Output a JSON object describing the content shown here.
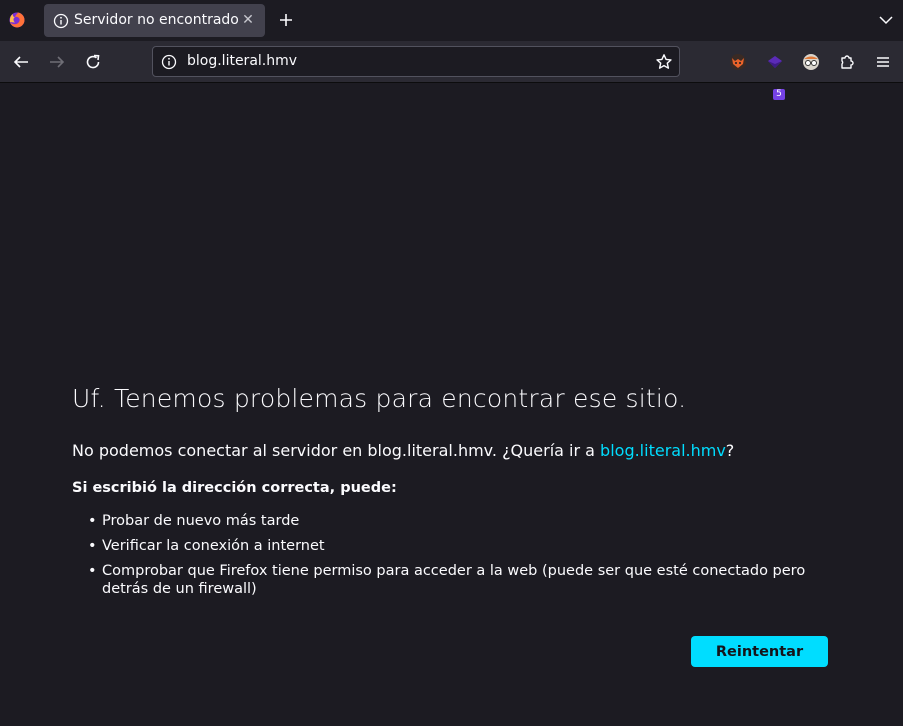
{
  "tab": {
    "title": "Servidor no encontrado",
    "close_glyph": "✕",
    "icon": "info-icon"
  },
  "browser": {
    "logo": "firefox-logo",
    "url": "blog.literal.hmv",
    "extensions": [
      "extension-fox-icon",
      "extension-purple-icon",
      "extension-glasses-icon",
      "extensions-puzzle-icon"
    ],
    "extension_badge": "5"
  },
  "error": {
    "title": "Uf. Tenemos problemas para encontrar ese sitio.",
    "desc_prefix": "No podemos conectar al servidor en blog.literal.hmv. ¿Quería ir a ",
    "suggest_link": "blog.literal.hmv",
    "desc_suffix": "?",
    "suggest_heading": "Si escribió la dirección correcta, puede:",
    "suggestions": [
      "Probar de nuevo más tarde",
      "Verificar la conexión a internet",
      "Comprobar que Firefox tiene permiso para acceder a la web (puede ser que esté conectado pero detrás de un firewall)"
    ],
    "retry_label": "Reintentar"
  },
  "colors": {
    "link": "#00ddff",
    "button": "#00ddff",
    "background": "#1c1b22",
    "toolbar": "#2b2a33"
  }
}
